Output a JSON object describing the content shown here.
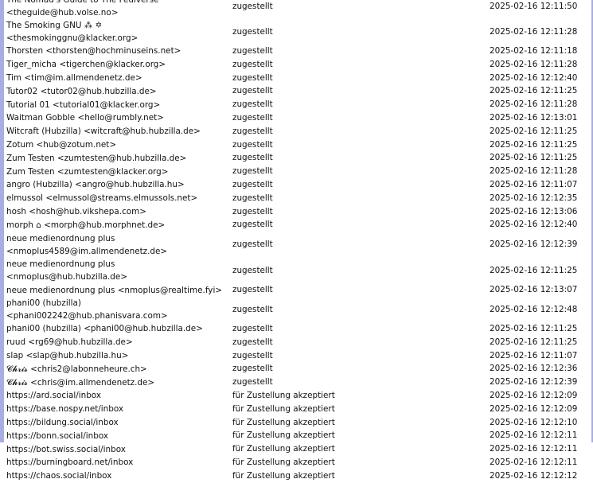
{
  "rows": [
    {
      "peer": "The Nomad's Guide to The Fediverse <theguide@hub.volse.no>",
      "status": "zugestellt",
      "time": "2025-02-16 12:11:50"
    },
    {
      "peer": "The Smoking GNU ⁂ ✡ <thesmokinggnu@klacker.org>",
      "status": "zugestellt",
      "time": "2025-02-16 12:11:28"
    },
    {
      "peer": "Thorsten <thorsten@hochminuseins.net>",
      "status": "zugestellt",
      "time": "2025-02-16 12:11:18"
    },
    {
      "peer": "Tiger_micha <tigerchen@klacker.org>",
      "status": "zugestellt",
      "time": "2025-02-16 12:11:28"
    },
    {
      "peer": "Tim <tim@im.allmendenetz.de>",
      "status": "zugestellt",
      "time": "2025-02-16 12:12:40"
    },
    {
      "peer": "Tutor02 <tutor02@hub.hubzilla.de>",
      "status": "zugestellt",
      "time": "2025-02-16 12:11:25"
    },
    {
      "peer": "Tutorial 01 <tutorial01@klacker.org>",
      "status": "zugestellt",
      "time": "2025-02-16 12:11:28"
    },
    {
      "peer": "Waitman Gobble <hello@rumbly.net>",
      "status": "zugestellt",
      "time": "2025-02-16 12:13:01"
    },
    {
      "peer": "Witcraft (Hubzilla) <witcraft@hub.hubzilla.de>",
      "status": "zugestellt",
      "time": "2025-02-16 12:11:25"
    },
    {
      "peer": "Zotum <hub@zotum.net>",
      "status": "zugestellt",
      "time": "2025-02-16 12:11:25"
    },
    {
      "peer": "Zum Testen <zumtesten@hub.hubzilla.de>",
      "status": "zugestellt",
      "time": "2025-02-16 12:11:25"
    },
    {
      "peer": "Zum Testen <zumtesten@klacker.org>",
      "status": "zugestellt",
      "time": "2025-02-16 12:11:28"
    },
    {
      "peer": "angro (Hubzilla) <angro@hub.hubzilla.hu>",
      "status": "zugestellt",
      "time": "2025-02-16 12:11:07"
    },
    {
      "peer": "elmussol <elmussol@streams.elmussols.net>",
      "status": "zugestellt",
      "time": "2025-02-16 12:12:35"
    },
    {
      "peer": "hosh <hosh@hub.vikshepa.com>",
      "status": "zugestellt",
      "time": "2025-02-16 12:13:06"
    },
    {
      "peer": "morph ⌂ <morph@hub.morphnet.de>",
      "status": "zugestellt",
      "time": "2025-02-16 12:12:40"
    },
    {
      "peer": "neue medienordnung plus <nmoplus4589@im.allmendenetz.de>",
      "status": "zugestellt",
      "time": "2025-02-16 12:12:39",
      "tall": true
    },
    {
      "peer": "neue medienordnung plus <nmoplus@hub.hubzilla.de>",
      "status": "zugestellt",
      "time": "2025-02-16 12:11:25"
    },
    {
      "peer": "neue medienordnung plus <nmoplus@realtime.fyi>",
      "status": "zugestellt",
      "time": "2025-02-16 12:13:07"
    },
    {
      "peer": "phani00 (hubzilla) <phani002242@hub.phanisvara.com>",
      "status": "zugestellt",
      "time": "2025-02-16 12:12:48"
    },
    {
      "peer": "phani00 (hubzilla) <phani00@hub.hubzilla.de>",
      "status": "zugestellt",
      "time": "2025-02-16 12:11:25"
    },
    {
      "peer": "ruud <rg69@hub.hubzilla.de>",
      "status": "zugestellt",
      "time": "2025-02-16 12:11:25"
    },
    {
      "peer": "slap <slap@hub.hubzilla.hu>",
      "status": "zugestellt",
      "time": "2025-02-16 12:11:07"
    },
    {
      "peer": "𝓒𝓱𝓻𝓲𝓼 <chris2@labonneheure.ch>",
      "status": "zugestellt",
      "time": "2025-02-16 12:12:36"
    },
    {
      "peer": "𝓒𝓱𝓻𝓲𝓼 <chris@im.allmendenetz.de>",
      "status": "zugestellt",
      "time": "2025-02-16 12:12:39"
    },
    {
      "peer": "https://ard.social/inbox",
      "status": "für Zustellung akzeptiert",
      "time": "2025-02-16 12:12:09"
    },
    {
      "peer": "https://base.nospy.net/inbox",
      "status": "für Zustellung akzeptiert",
      "time": "2025-02-16 12:12:09"
    },
    {
      "peer": "https://bildung.social/inbox",
      "status": "für Zustellung akzeptiert",
      "time": "2025-02-16 12:12:10"
    },
    {
      "peer": "https://bonn.social/inbox",
      "status": "für Zustellung akzeptiert",
      "time": "2025-02-16 12:12:11"
    },
    {
      "peer": "https://bot.swiss.social/inbox",
      "status": "für Zustellung akzeptiert",
      "time": "2025-02-16 12:12:11"
    },
    {
      "peer": "https://burningboard.net/inbox",
      "status": "für Zustellung akzeptiert",
      "time": "2025-02-16 12:12:11"
    },
    {
      "peer": "https://chaos.social/inbox",
      "status": "für Zustellung akzeptiert",
      "time": "2025-02-16 12:12:12"
    }
  ]
}
